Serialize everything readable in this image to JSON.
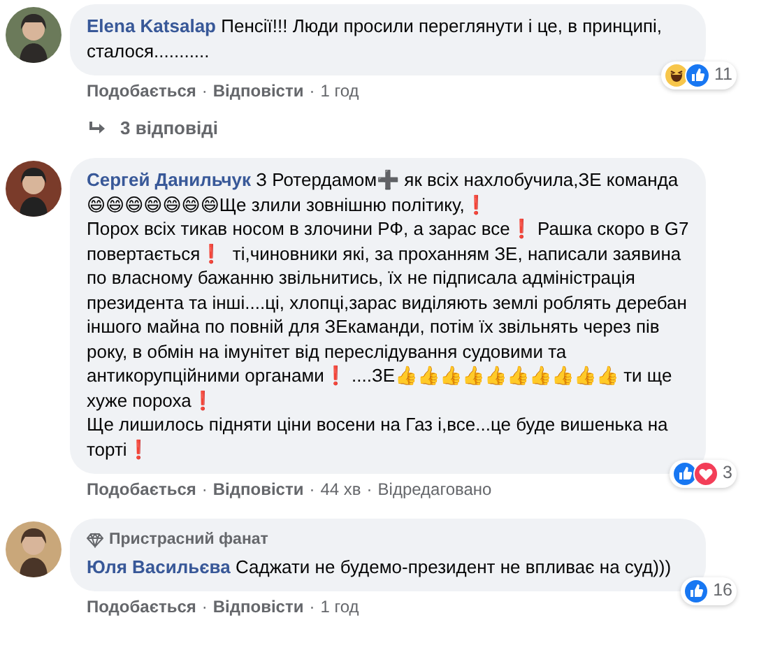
{
  "comments": [
    {
      "author": "Elena Katsalap",
      "text": "Пенсії!!! Люди просили переглянути і це, в принципі, сталося...........",
      "reactions": {
        "icons": [
          {
            "kind": "haha"
          },
          {
            "kind": "like"
          }
        ],
        "count": "11"
      },
      "actions": [
        {
          "kind": "link",
          "text": "Подобається"
        },
        {
          "kind": "separator",
          "text": "·"
        },
        {
          "kind": "link",
          "text": "Відповісти"
        },
        {
          "kind": "separator",
          "text": "·"
        },
        {
          "kind": "time",
          "text": "1 год"
        }
      ],
      "replies": "3 відповіді"
    },
    {
      "author": "Сергей Данильчук",
      "text": "З Ротердамом➕ як всіх нахлобучила,ЗЕ команда 😄😄😄😄😄😄😄Ще злили зовнішню політику,❗\nПорох всіх тикав носом в злочини РФ, а зарас все❗ Рашка скоро в G7 повертається❗  ті,чиновники які, за проханням ЗЕ, написали заявина по власному бажанню звільнитись, їх не підписала адміністрація президента та інші....ці, хлопці,зарас виділяють землі роблять деребан іншого майна по повній для ЗЕкаманди, потім їх звільнять через пів року, в обмін на імунітет від переслідування судовими та антикорупційними органами❗ ....ЗЕ👍👍👍👍👍👍👍👍👍👍 ти ще хуже пороха❗\nЩе лишилось підняти ціни восени на Газ і,все...це буде вишенька на торті❗",
      "reactions": {
        "icons": [
          {
            "kind": "like"
          },
          {
            "kind": "love"
          }
        ],
        "count": "3"
      },
      "actions": [
        {
          "kind": "link",
          "text": "Подобається"
        },
        {
          "kind": "separator",
          "text": "·"
        },
        {
          "kind": "link",
          "text": "Відповісти"
        },
        {
          "kind": "separator",
          "text": "·"
        },
        {
          "kind": "time",
          "text": "44 хв"
        },
        {
          "kind": "separator",
          "text": "·"
        },
        {
          "kind": "edited",
          "text": "Відредаговано"
        }
      ]
    },
    {
      "badge": "Пристрасний фанат",
      "author": "Юля Васильєва",
      "text": "Саджати не будемо-президент не впливає на суд)))",
      "reactions": {
        "icons": [
          {
            "kind": "like"
          }
        ],
        "count": "16"
      },
      "actions": [
        {
          "kind": "link",
          "text": "Подобається"
        },
        {
          "kind": "separator",
          "text": "·"
        },
        {
          "kind": "link",
          "text": "Відповісти"
        },
        {
          "kind": "separator",
          "text": "·"
        },
        {
          "kind": "time",
          "text": "1 год"
        }
      ]
    }
  ]
}
